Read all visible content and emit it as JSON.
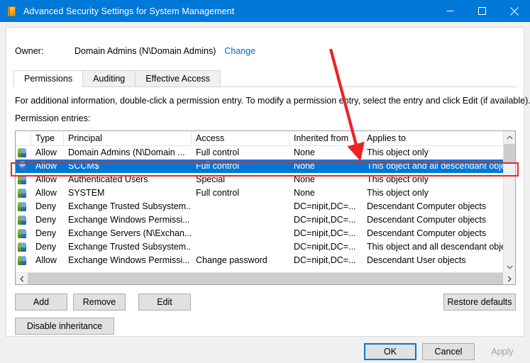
{
  "window": {
    "title": "Advanced Security Settings for System Management",
    "icon": "folder-icon",
    "accent_color": "#0078d7",
    "controls": {
      "minimize": "minimize-icon",
      "maximize": "maximize-icon",
      "close": "close-icon"
    }
  },
  "owner": {
    "label": "Owner:",
    "value": "Domain Admins (N\\Domain Admins)",
    "change_link": "Change"
  },
  "tabs": [
    {
      "label": "Permissions",
      "active": true
    },
    {
      "label": "Auditing",
      "active": false
    },
    {
      "label": "Effective Access",
      "active": false
    }
  ],
  "info_text": "For additional information, double-click a permission entry. To modify a permission entry, select the entry and click Edit (if available).",
  "entries_label": "Permission entries:",
  "table": {
    "columns": [
      "",
      "Type",
      "Principal",
      "Access",
      "Inherited from",
      "Applies to"
    ],
    "rows": [
      {
        "icon": "group-icon",
        "type": "Allow",
        "principal": "Domain Admins (N\\Domain ...",
        "access": "Full control",
        "inherited_from": "None",
        "applies_to": "This object only",
        "selected": false
      },
      {
        "icon": "user-icon",
        "type": "Allow",
        "principal": "SCCM$",
        "access": "Full control",
        "inherited_from": "None",
        "applies_to": "This object and all descendant objects",
        "selected": true
      },
      {
        "icon": "group-icon",
        "type": "Allow",
        "principal": "Authenticated Users",
        "access": "Special",
        "inherited_from": "None",
        "applies_to": "This object only",
        "selected": false
      },
      {
        "icon": "group-icon",
        "type": "Allow",
        "principal": "SYSTEM",
        "access": "Full control",
        "inherited_from": "None",
        "applies_to": "This object only",
        "selected": false
      },
      {
        "icon": "group-icon",
        "type": "Deny",
        "principal": "Exchange Trusted Subsystem...",
        "access": "",
        "inherited_from": "DC=nipit,DC=...",
        "applies_to": "Descendant Computer objects",
        "selected": false
      },
      {
        "icon": "group-icon",
        "type": "Deny",
        "principal": "Exchange Windows Permissi...",
        "access": "",
        "inherited_from": "DC=nipit,DC=...",
        "applies_to": "Descendant Computer objects",
        "selected": false
      },
      {
        "icon": "group-icon",
        "type": "Deny",
        "principal": "Exchange Servers (N\\Exchan...",
        "access": "",
        "inherited_from": "DC=nipit,DC=...",
        "applies_to": "Descendant Computer objects",
        "selected": false
      },
      {
        "icon": "group-icon",
        "type": "Deny",
        "principal": "Exchange Trusted Subsystem...",
        "access": "",
        "inherited_from": "DC=nipit,DC=...",
        "applies_to": "This object and all descendant objects",
        "selected": false
      },
      {
        "icon": "group-icon",
        "type": "Allow",
        "principal": "Exchange Windows Permissi...",
        "access": "Change password",
        "inherited_from": "DC=nipit,DC=...",
        "applies_to": "Descendant User objects",
        "selected": false
      }
    ],
    "selection_color": "#0078d7"
  },
  "buttons": {
    "add": "Add",
    "remove": "Remove",
    "edit": "Edit",
    "restore_defaults": "Restore defaults",
    "disable_inheritance": "Disable inheritance",
    "ok": "OK",
    "cancel": "Cancel",
    "apply": "Apply"
  },
  "annotations": {
    "arrow_color": "#ee2222",
    "highlight_box_color": "#ee2222"
  }
}
